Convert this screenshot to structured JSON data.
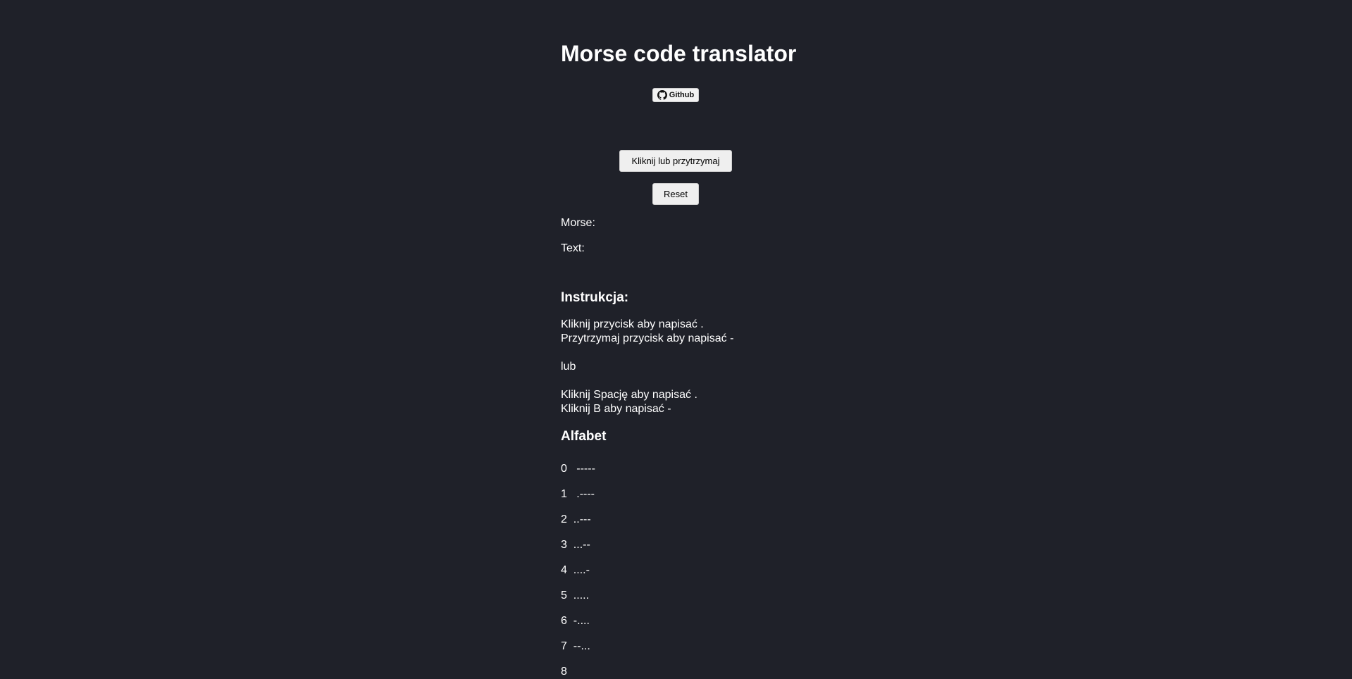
{
  "page": {
    "title": "Morse code translator",
    "github_label": "Github",
    "github_icon": "github-icon",
    "key_button_label": "Kliknij lub przytrzymaj",
    "reset_button_label": "Reset"
  },
  "output": {
    "morse_label": "Morse:",
    "morse_value": "",
    "text_label": "Text:",
    "text_value": ""
  },
  "instructions": {
    "heading": "Instrukcja:",
    "lines": [
      "Kliknij przycisk aby napisać .",
      "Przytrzymaj przycisk aby napisać -",
      "lub",
      "Kliknij Spację aby napisać .",
      "Kliknij B aby napisać -"
    ]
  },
  "alphabet": {
    "heading": "Alfabet",
    "rows": [
      {
        "char": "0",
        "code": "-----"
      },
      {
        "char": "1",
        "code": ".----"
      },
      {
        "char": "2",
        "code": "..---"
      },
      {
        "char": "3",
        "code": "...--"
      },
      {
        "char": "4",
        "code": "....-"
      },
      {
        "char": "5",
        "code": "....."
      },
      {
        "char": "6",
        "code": "-...."
      },
      {
        "char": "7",
        "code": "--..."
      },
      {
        "char": "8",
        "code": ""
      }
    ]
  },
  "colors": {
    "background": "#1f2129",
    "text": "#ffffff",
    "button": "#efefef"
  }
}
